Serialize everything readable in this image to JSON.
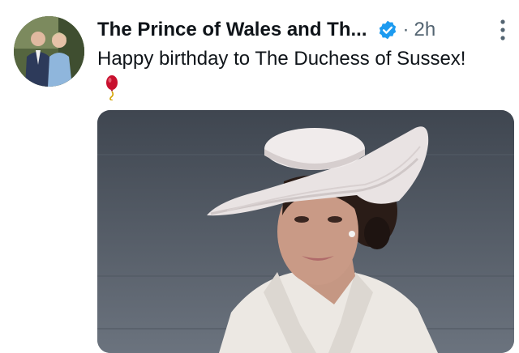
{
  "tweet": {
    "author": "The Prince of Wales and Th...",
    "separator": "·",
    "time": "2h",
    "text": "Happy birthday to The Duchess of Sussex!",
    "emoji": "balloon"
  },
  "icons": {
    "verified": "verified-badge-icon",
    "more": "more-options-icon"
  },
  "colors": {
    "text": "#0f1419",
    "secondary": "#536471",
    "verified": "#1d9bf0",
    "balloon": "#c8102e"
  }
}
